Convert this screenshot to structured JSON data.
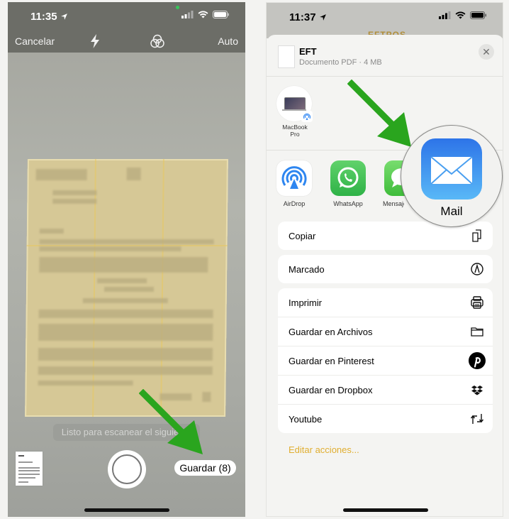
{
  "left_screen": {
    "status": {
      "time": "11:35"
    },
    "camera_bar": {
      "cancel_label": "Cancelar",
      "flash_icon": "lightning-bolt-icon",
      "filters_icon": "color-filters-icon",
      "mode_label": "Auto"
    },
    "toast": "Listo para escanear el siguiente",
    "save_button": "Guardar (8)",
    "accent_arrow_color": "#2aa51e"
  },
  "right_screen": {
    "status": {
      "time": "11:37"
    },
    "behind_title": "EFTPOS",
    "file": {
      "name": "EFT",
      "meta": "Documento PDF · 4 MB"
    },
    "airdrop_devices": [
      {
        "label_line1": "MacBook",
        "label_line2": "Pro"
      }
    ],
    "apps": [
      {
        "label": "AirDrop",
        "icon": "airdrop-icon"
      },
      {
        "label": "WhatsApp",
        "icon": "whatsapp-icon"
      },
      {
        "label": "Mensajes",
        "icon": "messages-icon"
      },
      {
        "label": "Mail",
        "icon": "mail-icon"
      }
    ],
    "magnified_app": {
      "label": "Mail"
    },
    "action_groups": [
      [
        {
          "label": "Copiar",
          "icon": "copy-icon"
        }
      ],
      [
        {
          "label": "Marcado",
          "icon": "markup-icon"
        }
      ],
      [
        {
          "label": "Imprimir",
          "icon": "printer-icon"
        },
        {
          "label": "Guardar en Archivos",
          "icon": "folder-icon"
        },
        {
          "label": "Guardar en Pinterest",
          "icon": "pinterest-icon"
        },
        {
          "label": "Guardar en Dropbox",
          "icon": "dropbox-icon"
        },
        {
          "label": "Youtube",
          "icon": "repeat-icon"
        }
      ]
    ],
    "edit_actions": "Editar acciones..."
  }
}
